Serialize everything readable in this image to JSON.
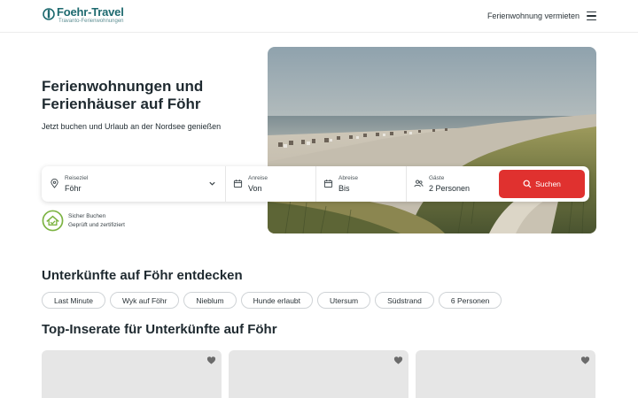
{
  "header": {
    "logo_title": "Foehr-Travel",
    "logo_sub": "Travanto-Ferienwohnungen",
    "host_link": "Ferienwohnung vermieten",
    "menu_icon": "hamburger-menu-icon"
  },
  "hero": {
    "title": "Ferienwohnungen und Ferienhäuser auf Föhr",
    "subtitle": "Jetzt buchen und Urlaub an der Nordsee genießen"
  },
  "search": {
    "destination_label": "Reiseziel",
    "destination_value": "Föhr",
    "arrival_label": "Anreise",
    "arrival_value": "Von",
    "departure_label": "Abreise",
    "departure_value": "Bis",
    "guests_label": "Gäste",
    "guests_value": "2 Personen",
    "submit_label": "Suchen"
  },
  "trust": {
    "title": "Sicher Buchen",
    "subtitle": "Geprüft und zertifiziert"
  },
  "discover": {
    "title": "Unterkünfte auf Föhr entdecken",
    "chips": [
      "Last Minute",
      "Wyk auf Föhr",
      "Nieblum",
      "Hunde erlaubt",
      "Utersum",
      "Südstrand",
      "6 Personen"
    ]
  },
  "top": {
    "title": "Top-Inserate für Unterkünfte auf Föhr"
  },
  "colors": {
    "brand": "#1e6a6f",
    "accent": "#e0312f",
    "trust_green": "#7cb342"
  }
}
